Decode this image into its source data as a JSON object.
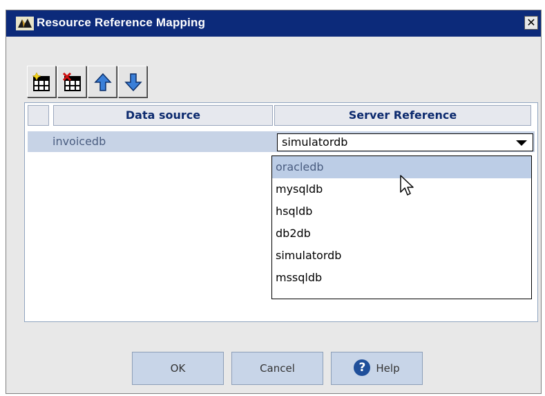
{
  "window": {
    "title": "Resource Reference Mapping",
    "close_glyph": "✕"
  },
  "toolbar": {
    "buttons": [
      {
        "icon": "add-row-icon"
      },
      {
        "icon": "delete-row-icon"
      },
      {
        "icon": "move-up-icon"
      },
      {
        "icon": "move-down-icon"
      }
    ]
  },
  "table": {
    "columns": [
      "",
      "Data source",
      "Server Reference"
    ],
    "rows": [
      {
        "data_source": "invoicedb",
        "server_reference": "simulatordb"
      }
    ]
  },
  "dropdown": {
    "options": [
      "oracledb",
      "mysqldb",
      "hsqldb",
      "db2db",
      "simulatordb",
      "mssqldb"
    ],
    "highlighted": "oracledb"
  },
  "buttons": {
    "ok": "OK",
    "cancel": "Cancel",
    "help": "Help",
    "help_glyph": "?"
  },
  "colors": {
    "titlebar": "#0c2a7a",
    "selection": "#bccde6",
    "header_text": "#0c2a6e"
  }
}
